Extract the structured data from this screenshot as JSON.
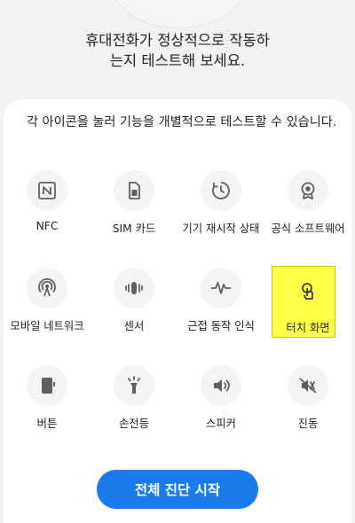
{
  "headline": {
    "line1": "휴대전화가 정상적으로 작동하",
    "line2": "는지 테스트해 보세요."
  },
  "instructions": "각 아이콘을 눌러 기능을 개별적으로 테스트할 수 있습니다.",
  "tests": [
    {
      "label": "NFC",
      "icon": "nfc-icon"
    },
    {
      "label": "SIM 카드",
      "icon": "sim-card-icon"
    },
    {
      "label": "기기 재시작 상태",
      "icon": "restart-status-icon"
    },
    {
      "label": "공식 소프트웨어",
      "icon": "official-software-badge-icon"
    },
    {
      "label": "모바일 네트워크",
      "icon": "mobile-network-icon"
    },
    {
      "label": "센서",
      "icon": "sensor-icon"
    },
    {
      "label": "근접 동작 인식",
      "icon": "proximity-gesture-icon"
    },
    {
      "label": "터치 화면",
      "icon": "touch-screen-icon",
      "highlighted": true
    },
    {
      "label": "버튼",
      "icon": "button-icon"
    },
    {
      "label": "손전등",
      "icon": "flashlight-icon"
    },
    {
      "label": "스피커",
      "icon": "speaker-icon"
    },
    {
      "label": "진동",
      "icon": "vibration-icon"
    }
  ],
  "start_button": "전체 진단 시작",
  "colors": {
    "accent": "#1a7bec",
    "highlight": "#ffff4a",
    "icon_gray": "#5f5f5f"
  }
}
